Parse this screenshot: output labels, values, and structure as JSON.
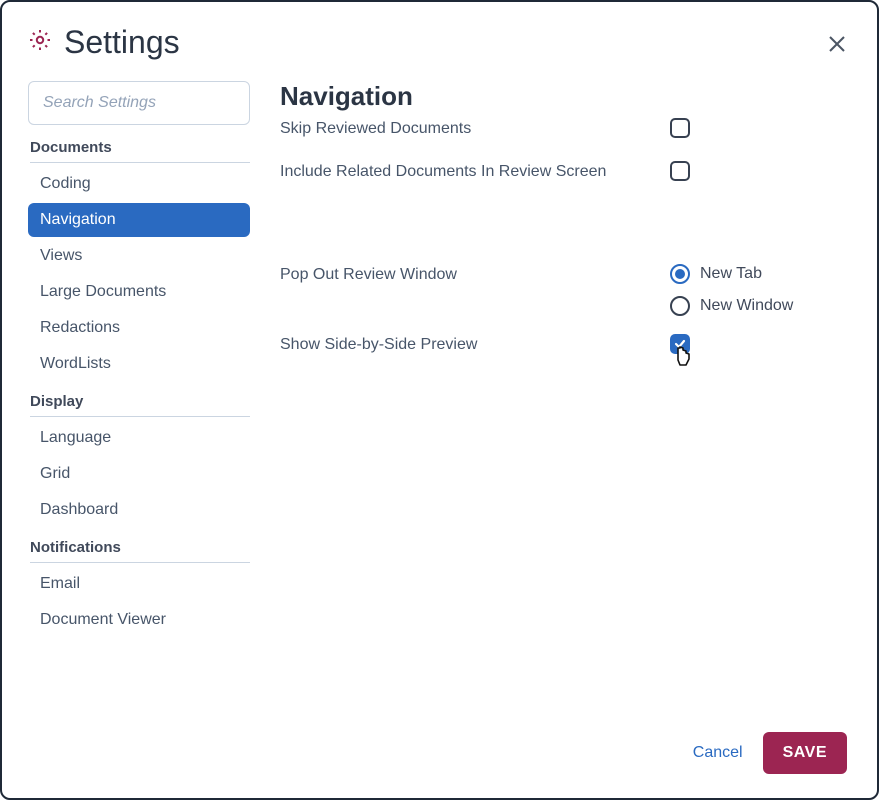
{
  "header": {
    "title": "Settings"
  },
  "search": {
    "placeholder": "Search Settings"
  },
  "sidebar": {
    "groups": [
      {
        "label": "Documents",
        "items": [
          {
            "label": "Coding",
            "active": false
          },
          {
            "label": "Navigation",
            "active": true
          },
          {
            "label": "Views",
            "active": false
          },
          {
            "label": "Large Documents",
            "active": false
          },
          {
            "label": "Redactions",
            "active": false
          },
          {
            "label": "WordLists",
            "active": false
          }
        ]
      },
      {
        "label": "Display",
        "items": [
          {
            "label": "Language",
            "active": false
          },
          {
            "label": "Grid",
            "active": false
          },
          {
            "label": "Dashboard",
            "active": false
          }
        ]
      },
      {
        "label": "Notifications",
        "items": [
          {
            "label": "Email",
            "active": false
          },
          {
            "label": "Document Viewer",
            "active": false
          }
        ]
      }
    ]
  },
  "content": {
    "heading": "Navigation",
    "skip_label": "Skip Reviewed Documents",
    "skip_checked": false,
    "include_label": "Include Related Documents In Review Screen",
    "include_checked": false,
    "popout_label": "Pop Out Review Window",
    "popout_options": [
      {
        "label": "New Tab",
        "selected": true
      },
      {
        "label": "New Window",
        "selected": false
      }
    ],
    "sidebyside_label": "Show Side-by-Side Preview",
    "sidebyside_checked": true
  },
  "footer": {
    "cancel_label": "Cancel",
    "save_label": "SAVE"
  },
  "colors": {
    "primary_blue": "#2a6ac1",
    "primary_magenta": "#9c2552"
  }
}
